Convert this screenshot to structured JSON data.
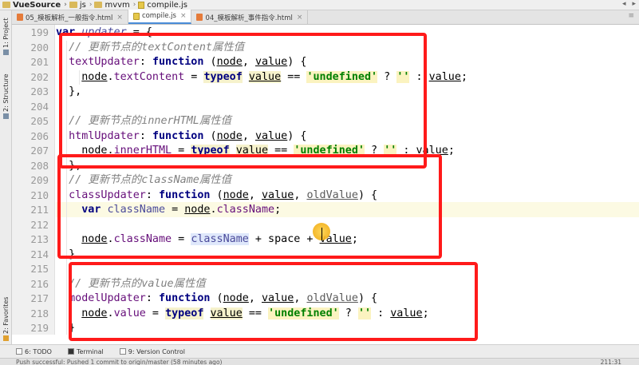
{
  "breadcrumb": {
    "items": [
      "VueSource",
      "js",
      "mvvm",
      "compile.js"
    ]
  },
  "tabs": [
    {
      "label": "05_模板解析_一般指令.html",
      "type": "html",
      "active": false
    },
    {
      "label": "compile.js",
      "type": "js",
      "active": true
    },
    {
      "label": "04_模板解析_事件指令.html",
      "type": "html",
      "active": false
    }
  ],
  "left_tools": {
    "project": "1: Project",
    "structure": "2: Structure",
    "favorites": "2: Favorites"
  },
  "editor": {
    "language": "javascript",
    "current_line": 211,
    "lines": [
      {
        "n": 199,
        "text": "var updater = {"
      },
      {
        "n": 200,
        "text": "  // 更新节点的textContent属性值"
      },
      {
        "n": 201,
        "text": "  textUpdater: function (node, value) {"
      },
      {
        "n": 202,
        "text": "    node.textContent = typeof value == 'undefined' ? '' : value;"
      },
      {
        "n": 203,
        "text": "  },"
      },
      {
        "n": 204,
        "text": ""
      },
      {
        "n": 205,
        "text": "  // 更新节点的innerHTML属性值"
      },
      {
        "n": 206,
        "text": "  htmlUpdater: function (node, value) {"
      },
      {
        "n": 207,
        "text": "    node.innerHTML = typeof value == 'undefined' ? '' : value;"
      },
      {
        "n": 208,
        "text": "  },"
      },
      {
        "n": 209,
        "text": "  // 更新节点的className属性值"
      },
      {
        "n": 210,
        "text": "  classUpdater: function (node, value, oldValue) {"
      },
      {
        "n": 211,
        "text": "    var className = node.className;"
      },
      {
        "n": 212,
        "text": ""
      },
      {
        "n": 213,
        "text": "    node.className = className + space + value;"
      },
      {
        "n": 214,
        "text": "  },"
      },
      {
        "n": 215,
        "text": ""
      },
      {
        "n": 216,
        "text": "  // 更新节点的value属性值"
      },
      {
        "n": 217,
        "text": "  modelUpdater: function (node, value, oldValue) {"
      },
      {
        "n": 218,
        "text": "    node.value = typeof value == 'undefined' ? '' : value;"
      },
      {
        "n": 219,
        "text": "  }"
      }
    ]
  },
  "bottom_tools": [
    "6: TODO",
    "Terminal",
    "9: Version Control"
  ],
  "status": {
    "message": "Push successful: Pushed 1 commit to origin/master (58 minutes ago)",
    "position": "211:31"
  },
  "colors": {
    "annotation_box": "#ff1a1a",
    "keyword": "#000080",
    "string": "#008000",
    "comment": "#808080",
    "property": "#660e7a",
    "current_line_bg": "#fcfae3"
  }
}
